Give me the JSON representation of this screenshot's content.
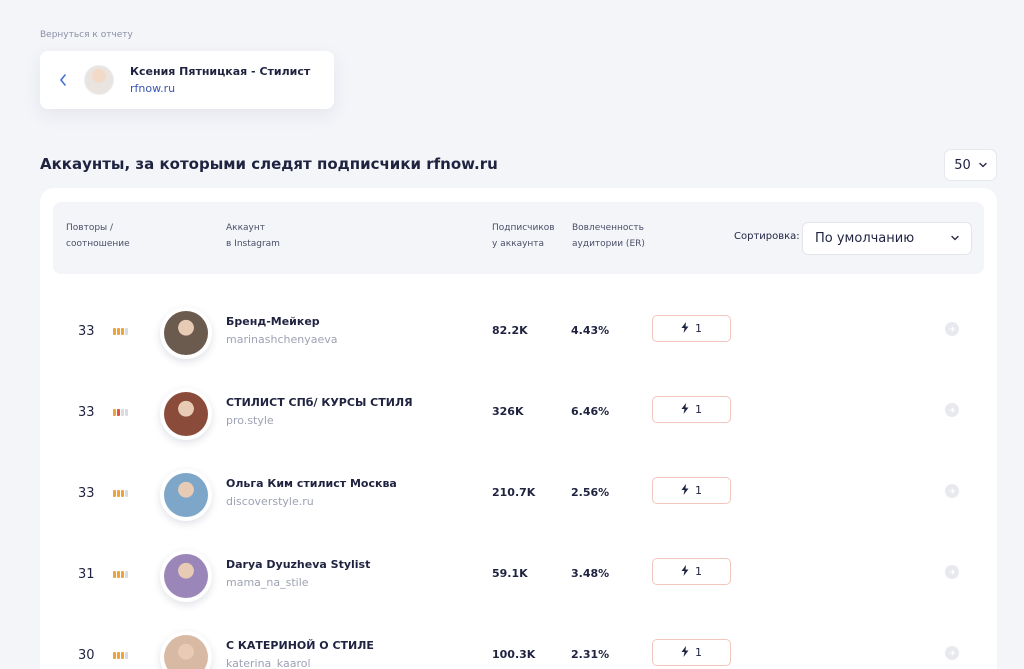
{
  "back_link": "Вернуться к отчету",
  "profile": {
    "name": "Ксения Пятницкая - Стилист",
    "site": "rfnow.ru"
  },
  "section_title": "Аккаунты, за которыми следят подписчики rfnow.ru",
  "per_page": "50",
  "table": {
    "headers": {
      "repeats": [
        "Повторы /",
        "соотношение"
      ],
      "account": [
        "Аккаунт",
        "в Instagram"
      ],
      "followers": [
        "Подписчиков",
        "у аккаунта"
      ],
      "engagement": [
        "Вовлеченность",
        "аудитории (ER)"
      ]
    },
    "sort_label": "Сортировка:",
    "sort_value": "По умолчанию",
    "rows": [
      {
        "repeats": "33",
        "ratio": [
          "on",
          "on",
          "on",
          "off"
        ],
        "name": "Бренд-Мейкер",
        "handle": "marinashchenyaeva",
        "followers": "82.2K",
        "er": "4.43%",
        "badge": "1",
        "avatar_color": "#6b5a4e"
      },
      {
        "repeats": "33",
        "ratio": [
          "on",
          "red",
          "off",
          "off"
        ],
        "name": "СТИЛИСТ СПб/ КУРСЫ СТИЛЯ",
        "handle": "pro.style",
        "followers": "326K",
        "er": "6.46%",
        "badge": "1",
        "avatar_color": "#8a4b3a"
      },
      {
        "repeats": "33",
        "ratio": [
          "on",
          "on",
          "on",
          "off"
        ],
        "name": "Ольга Ким стилист Москва",
        "handle": "discoverstyle.ru",
        "followers": "210.7K",
        "er": "2.56%",
        "badge": "1",
        "avatar_color": "#7ea6c9"
      },
      {
        "repeats": "31",
        "ratio": [
          "on",
          "on",
          "on",
          "off"
        ],
        "name": "Darya Dyuzheva Stylist",
        "handle": "mama_na_stile",
        "followers": "59.1K",
        "er": "3.48%",
        "badge": "1",
        "avatar_color": "#9a86b8"
      },
      {
        "repeats": "30",
        "ratio": [
          "on",
          "on",
          "on",
          "off"
        ],
        "name": "С КАТЕРИНОЙ О СТИЛЕ",
        "handle": "katerina_kaarol",
        "followers": "100.3K",
        "er": "2.31%",
        "badge": "1",
        "avatar_color": "#d8b9a4"
      }
    ]
  },
  "icons": {
    "back": "chevron-left-icon",
    "dropdown": "chevron-down-icon",
    "badge": "lightning-icon",
    "row_action": "arrow-right-circle-icon"
  },
  "colors": {
    "accent": "#3a56b5",
    "ratio_on": "#f0a23a",
    "ratio_red": "#e5533d",
    "badge_border": "#f2c6bc"
  }
}
